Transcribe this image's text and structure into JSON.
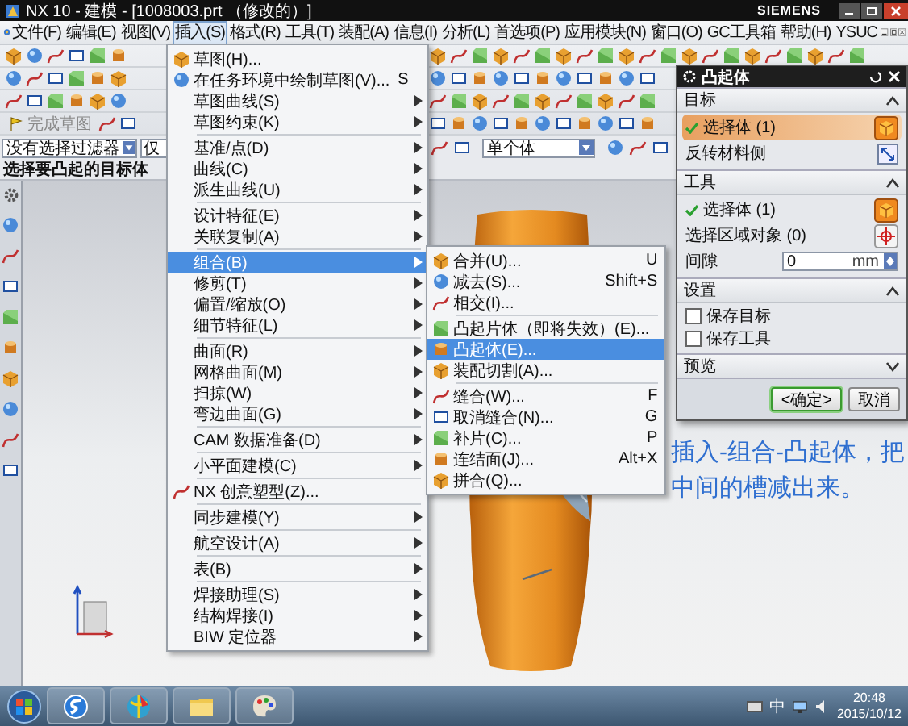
{
  "window": {
    "title": "NX 10 - 建模 - [1008003.prt （修改的）]",
    "brand": "SIEMENS"
  },
  "menu_bar": [
    {
      "label": "文件(F)",
      "selected": false
    },
    {
      "label": "编辑(E)",
      "selected": false
    },
    {
      "label": "视图(V)",
      "selected": false
    },
    {
      "label": "插入(S)",
      "selected": true
    },
    {
      "label": "格式(R)",
      "selected": false
    },
    {
      "label": "工具(T)",
      "selected": false
    },
    {
      "label": "装配(A)",
      "selected": false
    },
    {
      "label": "信息(I)",
      "selected": false
    },
    {
      "label": "分析(L)",
      "selected": false
    },
    {
      "label": "首选项(P)",
      "selected": false
    },
    {
      "label": "应用模块(N)",
      "selected": false
    },
    {
      "label": "窗口(O)",
      "selected": false
    },
    {
      "label": "GC工具箱",
      "selected": false
    },
    {
      "label": "帮助(H)",
      "selected": false
    },
    {
      "label": "YSUC",
      "selected": false
    }
  ],
  "toolbar": {
    "finish_sketch": "完成草图"
  },
  "selection_bar": {
    "filter": "没有选择过滤器",
    "scope": "仅",
    "body_rule": "单个体"
  },
  "cue_line": "选择要凸起的目标体",
  "insert_menu": [
    {
      "kind": "icon_item",
      "label": "草图(H)...",
      "has_submenu": false,
      "selected": false
    },
    {
      "kind": "icon_item",
      "label": "在任务环境中绘制草图(V)...",
      "shortcut": "S",
      "has_submenu": false,
      "selected": false
    },
    {
      "kind": "item",
      "label": "草图曲线(S)",
      "has_submenu": true,
      "selected": false
    },
    {
      "kind": "item",
      "label": "草图约束(K)",
      "has_submenu": true,
      "selected": false
    },
    {
      "kind": "separator"
    },
    {
      "kind": "item",
      "label": "基准/点(D)",
      "has_submenu": true,
      "selected": false
    },
    {
      "kind": "item",
      "label": "曲线(C)",
      "has_submenu": true,
      "selected": false
    },
    {
      "kind": "item",
      "label": "派生曲线(U)",
      "has_submenu": true,
      "selected": false
    },
    {
      "kind": "separator"
    },
    {
      "kind": "item",
      "label": "设计特征(E)",
      "has_submenu": true,
      "selected": false
    },
    {
      "kind": "item",
      "label": "关联复制(A)",
      "has_submenu": true,
      "selected": false
    },
    {
      "kind": "separator"
    },
    {
      "kind": "item",
      "label": "组合(B)",
      "has_submenu": true,
      "selected": true
    },
    {
      "kind": "item",
      "label": "修剪(T)",
      "has_submenu": true,
      "selected": false
    },
    {
      "kind": "item",
      "label": "偏置/缩放(O)",
      "has_submenu": true,
      "selected": false
    },
    {
      "kind": "item",
      "label": "细节特征(L)",
      "has_submenu": true,
      "selected": false
    },
    {
      "kind": "separator"
    },
    {
      "kind": "item",
      "label": "曲面(R)",
      "has_submenu": true,
      "selected": false
    },
    {
      "kind": "item",
      "label": "网格曲面(M)",
      "has_submenu": true,
      "selected": false
    },
    {
      "kind": "item",
      "label": "扫掠(W)",
      "has_submenu": true,
      "selected": false
    },
    {
      "kind": "item",
      "label": "弯边曲面(G)",
      "has_submenu": true,
      "selected": false
    },
    {
      "kind": "separator"
    },
    {
      "kind": "item",
      "label": "CAM 数据准备(D)",
      "has_submenu": true,
      "selected": false
    },
    {
      "kind": "separator"
    },
    {
      "kind": "item",
      "label": "小平面建模(C)",
      "has_submenu": true,
      "selected": false
    },
    {
      "kind": "separator"
    },
    {
      "kind": "icon_item",
      "label": "NX 创意塑型(Z)...",
      "has_submenu": false,
      "selected": false
    },
    {
      "kind": "separator"
    },
    {
      "kind": "item",
      "label": "同步建模(Y)",
      "has_submenu": true,
      "selected": false
    },
    {
      "kind": "separator"
    },
    {
      "kind": "item",
      "label": "航空设计(A)",
      "has_submenu": true,
      "selected": false
    },
    {
      "kind": "separator"
    },
    {
      "kind": "item",
      "label": "表(B)",
      "has_submenu": true,
      "selected": false
    },
    {
      "kind": "separator"
    },
    {
      "kind": "item",
      "label": "焊接助理(S)",
      "has_submenu": true,
      "selected": false
    },
    {
      "kind": "item",
      "label": "结构焊接(I)",
      "has_submenu": true,
      "selected": false
    },
    {
      "kind": "item",
      "label": "BIW 定位器",
      "has_submenu": true,
      "selected": false
    }
  ],
  "combine_submenu": [
    {
      "kind": "icon_item",
      "label": "合并(U)...",
      "shortcut": "U",
      "selected": false
    },
    {
      "kind": "icon_item",
      "label": "减去(S)...",
      "shortcut": "Shift+S",
      "selected": false
    },
    {
      "kind": "icon_item",
      "label": "相交(I)...",
      "selected": false
    },
    {
      "kind": "separator"
    },
    {
      "kind": "icon_item",
      "label": "凸起片体（即将失效）(E)...",
      "selected": false
    },
    {
      "kind": "icon_item",
      "label": "凸起体(E)...",
      "selected": true
    },
    {
      "kind": "icon_item",
      "label": "装配切割(A)...",
      "selected": false
    },
    {
      "kind": "separator"
    },
    {
      "kind": "icon_item",
      "label": "缝合(W)...",
      "shortcut": "F",
      "selected": false
    },
    {
      "kind": "icon_item",
      "label": "取消缝合(N)...",
      "shortcut": "G",
      "selected": false
    },
    {
      "kind": "icon_item",
      "label": "补片(C)...",
      "shortcut": "P",
      "selected": false
    },
    {
      "kind": "icon_item",
      "label": "连结面(J)...",
      "shortcut": "Alt+X",
      "selected": false
    },
    {
      "kind": "icon_item",
      "label": "拼合(Q)...",
      "selected": false
    }
  ],
  "dialog": {
    "title": "凸起体",
    "sections": [
      {
        "title": "目标",
        "expanded": true,
        "rows": [
          {
            "kind": "select_body",
            "label": "选择体 (1)",
            "done": true,
            "selected": true
          },
          {
            "kind": "reverse",
            "label": "反转材料侧"
          }
        ]
      },
      {
        "title": "工具",
        "expanded": true,
        "rows": [
          {
            "kind": "select_body",
            "label": "选择体 (1)",
            "done": true,
            "selected": false
          },
          {
            "kind": "select_region",
            "label": "选择区域对象 (0)",
            "done": false,
            "selected": false
          },
          {
            "kind": "distance",
            "label": "间隙",
            "value": "0",
            "unit": "mm"
          }
        ]
      },
      {
        "title": "设置",
        "expanded": true,
        "rows": [
          {
            "kind": "checkbox",
            "label": "保存目标",
            "checked": false
          },
          {
            "kind": "checkbox",
            "label": "保存工具",
            "checked": false
          }
        ]
      },
      {
        "title": "预览",
        "expanded": false
      }
    ],
    "buttons": [
      {
        "label": "<确定>",
        "default": true
      },
      {
        "label": "取消",
        "default": false
      }
    ]
  },
  "annotation": "插入-组合-凸起体，把中间的槽减出来。",
  "taskbar": {
    "ime": "中",
    "time": "20:48",
    "date": "2015/10/12"
  }
}
